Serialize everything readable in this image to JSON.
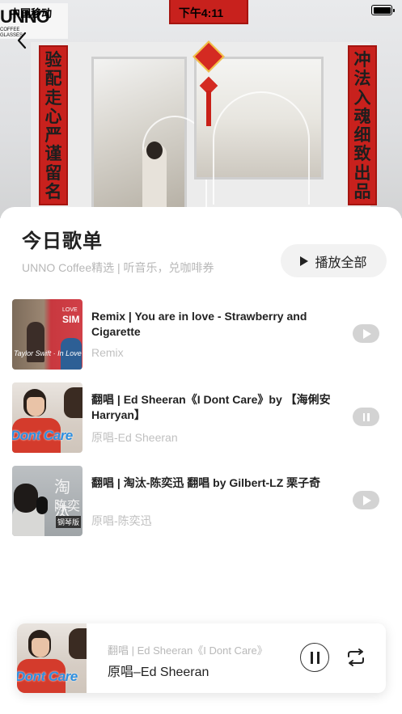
{
  "status_bar": {
    "carrier": "中国移动",
    "time": "下午4:11"
  },
  "hero": {
    "shop_logo": "UNNO",
    "shop_logo_small": "COFFEE GLASSES",
    "couplet_left": [
      "验",
      "配",
      "走",
      "心",
      "严",
      "谨",
      "留",
      "名"
    ],
    "couplet_right": [
      "冲",
      "法",
      "入",
      "魂",
      "细",
      "致",
      "出",
      "品"
    ]
  },
  "playlist": {
    "title": "今日歌单",
    "subtitle": "UNNO Coffee精选 | 听音乐，兑咖啡券",
    "play_all_label": "播放全部"
  },
  "songs": [
    {
      "title": "Remix |  You are in love - Strawberry and Cigarette",
      "subtitle": "Remix",
      "state": "play",
      "cover_texts": [
        "Taylor Swift · In Love",
        "LOVE",
        "SIM"
      ]
    },
    {
      "title": "翻唱 | Ed Sheeran《I Dont Care》by 【海俐安Harryan】",
      "subtitle": "原唱-Ed Sheeran",
      "state": "pause",
      "cover_texts": [
        "Dont Care"
      ]
    },
    {
      "title": "翻唱 | 淘汰-陈奕迅 翻唱 by Gilbert-LZ 栗子奇",
      "subtitle": "原唱-陈奕迅",
      "state": "play",
      "cover_texts": [
        "淘汰",
        "陈奕",
        "钢琴版"
      ]
    }
  ],
  "player": {
    "title": "翻唱 | Ed Sheeran《I Dont Care》",
    "subtitle": "原唱–Ed Sheeran",
    "cover_text": "Dont Care"
  }
}
